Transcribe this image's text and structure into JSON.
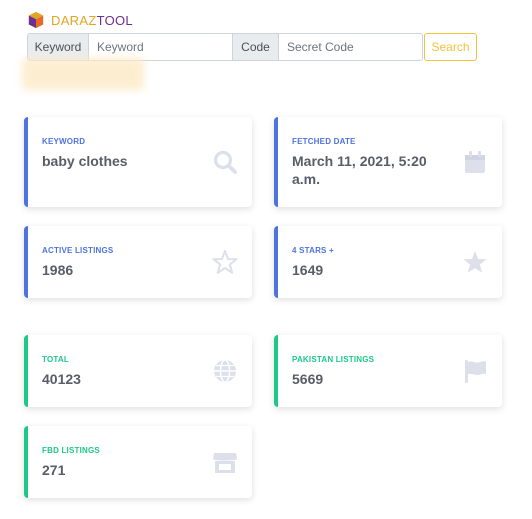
{
  "brand": {
    "part1": "DARAZ",
    "part2": "TOOL"
  },
  "search": {
    "keyword_addon": "Keyword",
    "keyword_placeholder": "Keyword",
    "code_addon": "Code",
    "code_placeholder": "Secret Code",
    "button_label": "Search"
  },
  "cards": {
    "keyword": {
      "label": "KEYWORD",
      "value": "baby clothes",
      "icon": "search-icon"
    },
    "fetched": {
      "label": "FETCHED DATE",
      "value": "March 11, 2021, 5:20 a.m.",
      "icon": "calendar-icon"
    },
    "active": {
      "label": "ACTIVE LISTINGS",
      "value": "1986",
      "icon": "star-outline-icon"
    },
    "stars4": {
      "label": "4 STARS +",
      "value": "1649",
      "icon": "star-icon"
    },
    "total": {
      "label": "TOTAL",
      "value": "40123",
      "icon": "globe-icon"
    },
    "pakistan": {
      "label": "PAKISTAN LISTINGS",
      "value": "5669",
      "icon": "flag-icon"
    },
    "fbd": {
      "label": "FBD LISTINGS",
      "value": "271",
      "icon": "store-icon"
    }
  },
  "colors": {
    "primary": "#4e73df",
    "success": "#1cc88a",
    "warning": "#f6c23e",
    "icon": "#dddfeb"
  }
}
